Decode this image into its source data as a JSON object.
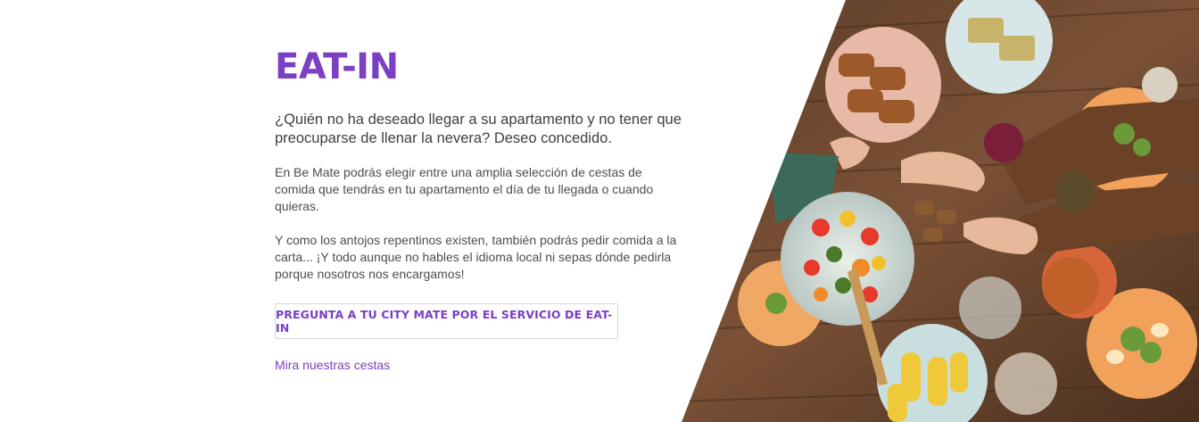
{
  "section": {
    "title": "EAT-IN",
    "lead": "¿Quién no ha deseado llegar a su apartamento y no tener que preocuparse de llenar la nevera? Deseo concedido.",
    "paragraph_1": "En Be Mate podrás elegir entre una amplia selección de cestas de comida que tendrás en tu apartamento el día de tu llegada o cuando quieras.",
    "paragraph_2": "Y como los antojos repentinos existen, también podrás pedir comida a la carta... ¡Y todo aunque no hables el idioma local ni sepas dónde pedirla porque nosotros nos encargamos!",
    "cta_label": "PREGUNTA A TU CITY MATE POR EL SERVICIO DE EAT-IN",
    "link_label": "Mira nuestras cestas"
  },
  "colors": {
    "accent": "#7b3fc4",
    "text": "#4a4a4a",
    "table_wood": "#6b4a32"
  }
}
